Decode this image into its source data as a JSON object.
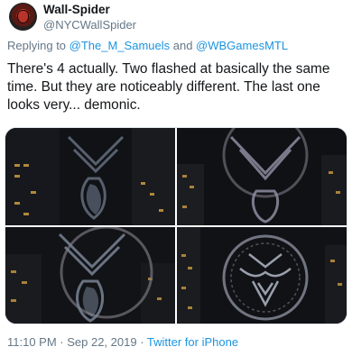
{
  "user": {
    "name": "Wall-Spider",
    "handle": "@NYCWallSpider"
  },
  "reply": {
    "prefix": "Replying to ",
    "mention1": "@The_M_Samuels",
    "conjunction": " and ",
    "mention2": "@WBGamesMTL"
  },
  "tweet": {
    "text": "There's 4 actually. Two flashed at basically the same time. But they are noticeably different. The last one looks very... demonic."
  },
  "footer": {
    "time": "11:10 PM · Sep 22, 2019 · ",
    "source": "Twitter for iPhone"
  },
  "colors": {
    "link": "#1b95e0",
    "secondary_text": "#657786"
  }
}
